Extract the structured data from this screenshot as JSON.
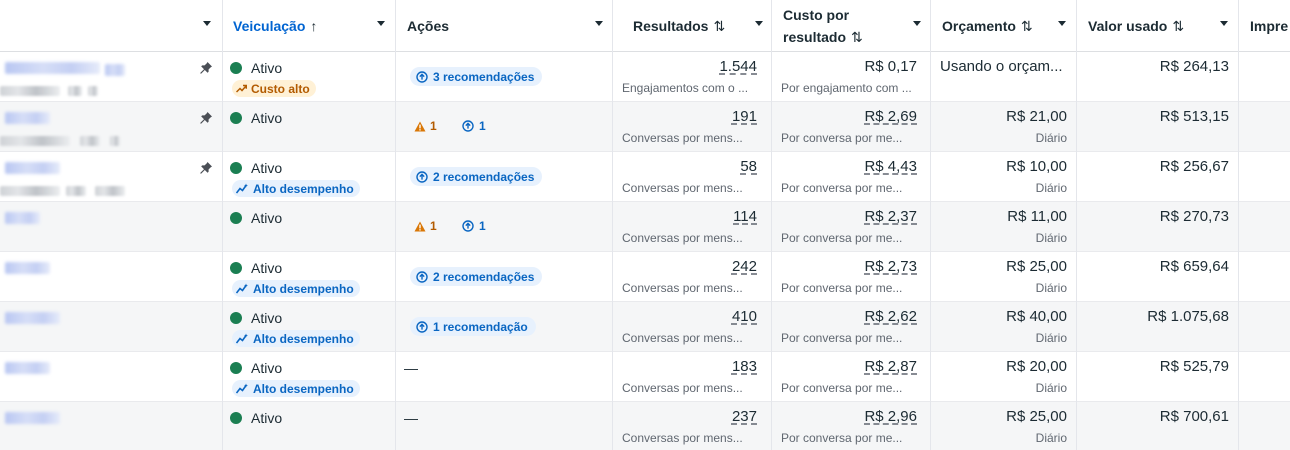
{
  "header": {
    "delivery": "Veiculação",
    "actions": "Ações",
    "results": "Resultados",
    "cost_per_result_line1": "Custo por",
    "cost_per_result_line2": "resultado",
    "budget": "Orçamento",
    "amount_spent": "Valor usado",
    "impressions": "Impre"
  },
  "icons": {
    "sort_arrow": "↑",
    "sort_both": "⇅",
    "pin": "pin-icon",
    "recommendation": "arrow-circle-up-icon",
    "warning": "warning-triangle-icon",
    "trend_up": "trend-up-icon",
    "performance": "sparkline-icon"
  },
  "colors": {
    "active_green": "#1b7f52",
    "accent_blue": "#0064d1",
    "warning_orange": "#b35b00"
  },
  "rows": [
    {
      "status": "Ativo",
      "badge": "Custo alto",
      "actions": "3 recomendações",
      "results": "1.544",
      "results_sub": "Engajamentos com o ...",
      "cost": "R$ 0,17",
      "cost_sub": "Por engajamento com ...",
      "budget": "Usando o orçam...",
      "budget_sub": "",
      "spent": "R$ 264,13"
    },
    {
      "status": "Ativo",
      "warnings": "1",
      "recs": "1",
      "results": "191",
      "results_sub": "Conversas por mens...",
      "cost": "R$ 2,69",
      "cost_sub": "Por conversa por me...",
      "budget": "R$ 21,00",
      "budget_sub": "Diário",
      "spent": "R$ 513,15"
    },
    {
      "status": "Ativo",
      "badge": "Alto desempenho",
      "actions": "2 recomendações",
      "results": "58",
      "results_sub": "Conversas por mens...",
      "cost": "R$ 4,43",
      "cost_sub": "Por conversa por me...",
      "budget": "R$ 10,00",
      "budget_sub": "Diário",
      "spent": "R$ 256,67"
    },
    {
      "status": "Ativo",
      "warnings": "1",
      "recs": "1",
      "results": "114",
      "results_sub": "Conversas por mens...",
      "cost": "R$ 2,37",
      "cost_sub": "Por conversa por me...",
      "budget": "R$ 11,00",
      "budget_sub": "Diário",
      "spent": "R$ 270,73"
    },
    {
      "status": "Ativo",
      "badge": "Alto desempenho",
      "actions": "2 recomendações",
      "results": "242",
      "results_sub": "Conversas por mens...",
      "cost": "R$ 2,73",
      "cost_sub": "Por conversa por me...",
      "budget": "R$ 25,00",
      "budget_sub": "Diário",
      "spent": "R$ 659,64"
    },
    {
      "status": "Ativo",
      "badge": "Alto desempenho",
      "actions": "1 recomendação",
      "results": "410",
      "results_sub": "Conversas por mens...",
      "cost": "R$ 2,62",
      "cost_sub": "Por conversa por me...",
      "budget": "R$ 40,00",
      "budget_sub": "Diário",
      "spent": "R$ 1.075,68"
    },
    {
      "status": "Ativo",
      "badge": "Alto desempenho",
      "actions": "—",
      "results": "183",
      "results_sub": "Conversas por mens...",
      "cost": "R$ 2,87",
      "cost_sub": "Por conversa por me...",
      "budget": "R$ 20,00",
      "budget_sub": "Diário",
      "spent": "R$ 525,79"
    },
    {
      "status": "Ativo",
      "actions": "—",
      "results": "237",
      "results_sub": "Conversas por mens...",
      "cost": "R$ 2,96",
      "cost_sub": "Por conversa por me...",
      "budget": "R$ 25,00",
      "budget_sub": "Diário",
      "spent": "R$ 700,61"
    }
  ]
}
